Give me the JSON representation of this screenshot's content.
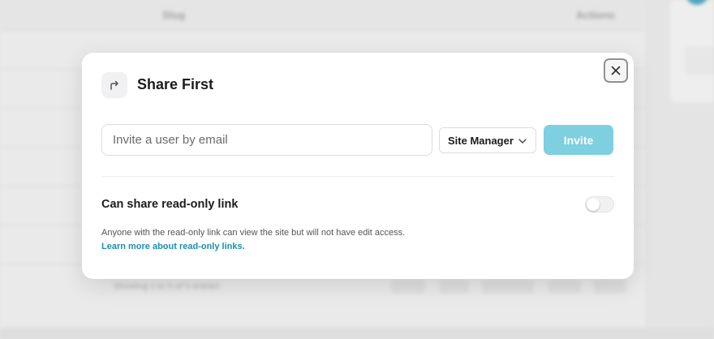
{
  "background": {
    "table_headers": [
      "Slug",
      "Actions"
    ],
    "footer_text": "Showing 1 to 5 of 5 entries",
    "pager": [
      "« First",
      "‹ Prev",
      "Page 1 of 1",
      "Next ›",
      "Last »"
    ]
  },
  "modal": {
    "title": "Share First",
    "header_icon": "share-arrow-icon",
    "close_icon": "close-icon",
    "invite": {
      "email_placeholder": "Invite a user by email",
      "email_value": "",
      "role_selected": "Site Manager",
      "button_label": "Invite"
    },
    "readonly": {
      "label": "Can share read-only link",
      "enabled": false,
      "description": "Anyone with the read-only link can view the site but will not have edit access.",
      "link_text": "Learn more about read-only links."
    }
  },
  "colors": {
    "accent": "#7ecfe0",
    "link": "#1a8fb0",
    "title": "#1c1c1c"
  }
}
